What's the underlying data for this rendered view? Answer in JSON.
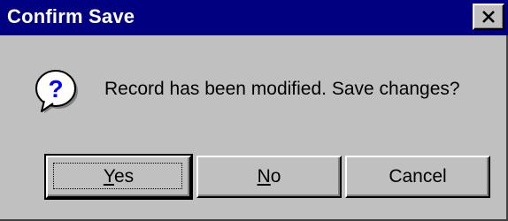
{
  "dialog": {
    "title": "Confirm Save",
    "message": "Record has been modified. Save changes?",
    "icon": "question-icon",
    "colors": {
      "title_bar": "#000080",
      "title_text": "#ffffff",
      "face": "#c0c0c0"
    }
  },
  "buttons": {
    "yes": {
      "mnemonic": "Y",
      "rest": "es"
    },
    "no": {
      "mnemonic": "N",
      "rest": "o"
    },
    "cancel": {
      "label": "Cancel"
    }
  }
}
